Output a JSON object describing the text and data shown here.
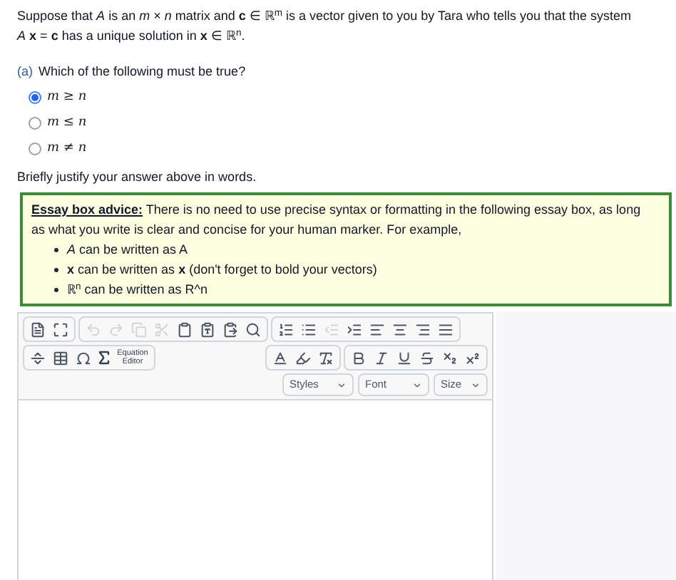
{
  "question": {
    "intro": "Suppose that *A* is an *m* × *n* matrix and **c** ∈ ℝ$^{m}$ is a vector given to you by Tara who tells you that the system *A* **x** = **c** has a unique solution in **x** ∈ ℝ$^{n}$."
  },
  "part": {
    "label": "(a)",
    "prompt": "Which of the following must be true?",
    "options": [
      {
        "text": "*m* ≥ *n*",
        "selected": true
      },
      {
        "text": "*m* ≤ *n*",
        "selected": false
      },
      {
        "text": "*m* ≠ *n*",
        "selected": false
      }
    ]
  },
  "justify_prompt": "Briefly justify your answer above in words.",
  "advice": {
    "text": "**Essay box advice:** There is no need to use precise syntax or formatting in the following essay box, as long as what you write is clear and concise for your human marker. For example,",
    "items": [
      "*A* can be written as A",
      "**x** can be written as **x** (don't forget to bold your vectors)",
      "ℝ$^{n}$ can be written as R^n"
    ]
  },
  "editor": {
    "equation_label": "Equation Editor",
    "dropdowns": [
      "Styles",
      "Font",
      "Size"
    ]
  }
}
